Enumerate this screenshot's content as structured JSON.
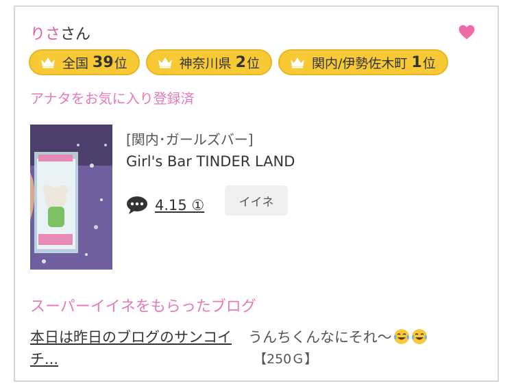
{
  "user": {
    "name": "りさ",
    "suffix": "さん"
  },
  "badges": [
    {
      "area": "全国",
      "rank": "39",
      "suffix": "位"
    },
    {
      "area": "神奈川県",
      "rank": "2",
      "suffix": "位"
    },
    {
      "area": "関内/伊勢佐木町",
      "rank": "1",
      "suffix": "位"
    }
  ],
  "favorite_status": "アナタをお気に入り登録済",
  "shop": {
    "category": "[関内･ガールズバー]",
    "name": "Girl's Bar TINDER LAND",
    "rating": "4.15 ①"
  },
  "iine_button": "イイネ",
  "blog": {
    "heading": "スーパーイイネをもらったブログ",
    "title": "本日は昨日のブログのサンコイチ...",
    "comment": "うんちくんなにそれ〜",
    "points": "【250Ｇ】"
  },
  "colors": {
    "pink": "#e879b8",
    "heart": "#f06aa7",
    "badge": "#f6c935"
  },
  "icons": [
    "heart-icon",
    "crown-icon",
    "comment-bubble-icon",
    "tears-of-joy-emoji"
  ]
}
